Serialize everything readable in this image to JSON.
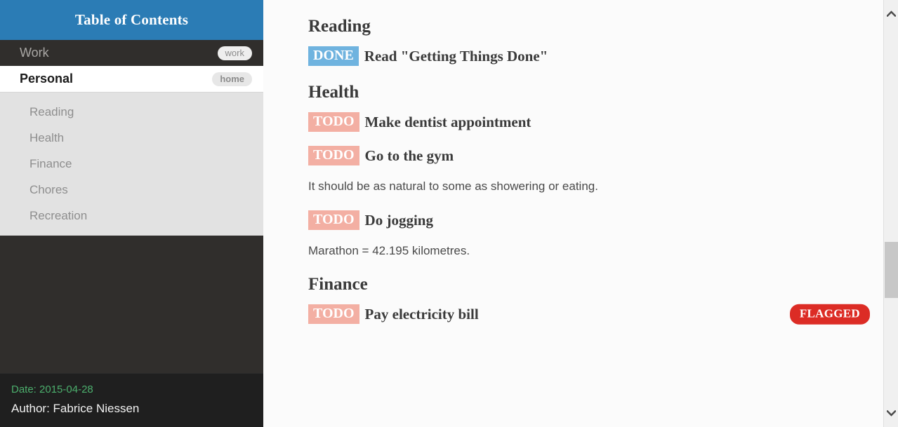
{
  "sidebar": {
    "header_title": "Table of Contents",
    "top_items": [
      {
        "label": "Work",
        "tag": "work",
        "state": "inactive"
      },
      {
        "label": "Personal",
        "tag": "home",
        "state": "active"
      }
    ],
    "children": [
      {
        "label": "Reading"
      },
      {
        "label": "Health"
      },
      {
        "label": "Finance"
      },
      {
        "label": "Chores"
      },
      {
        "label": "Recreation"
      }
    ],
    "footer": {
      "date": "Date: 2015-04-28",
      "author": "Author: Fabrice Niessen"
    }
  },
  "main": {
    "sections": [
      {
        "heading": "Reading",
        "tasks": [
          {
            "keyword": "DONE",
            "keyword_type": "done",
            "title": "Read \"Getting Things Done\"",
            "flag": ""
          }
        ],
        "paragraphs": []
      },
      {
        "heading": "Health",
        "tasks": [
          {
            "keyword": "TODO",
            "keyword_type": "todo",
            "title": "Make dentist appointment",
            "flag": ""
          },
          {
            "keyword": "TODO",
            "keyword_type": "todo",
            "title": "Go to the gym",
            "flag": ""
          }
        ],
        "paragraphs": [
          "It should be as natural to some as showering or eating.",
          "Marathon = 42.195 kilometres."
        ]
      },
      {
        "heading": "Finance",
        "tasks": [
          {
            "keyword": "TODO",
            "keyword_type": "todo",
            "title": "Pay electricity bill",
            "flag": "FLAGGED"
          }
        ],
        "paragraphs": []
      }
    ],
    "flow": {
      "reading_heading": "Reading",
      "reading_task_kw": "DONE",
      "reading_task_title": "Read \"Getting Things Done\"",
      "health_heading": "Health",
      "health_task1_kw": "TODO",
      "health_task1_title": "Make dentist appointment",
      "health_task2_kw": "TODO",
      "health_task2_title": "Go to the gym",
      "health_para1": "It should be as natural to some as showering or eating.",
      "health_task3_kw": "TODO",
      "health_task3_title": "Do jogging",
      "health_para2": "Marathon = 42.195 kilometres.",
      "finance_heading": "Finance",
      "finance_task1_kw": "TODO",
      "finance_task1_title": "Pay electricity bill",
      "finance_task1_flag": "FLAGGED"
    }
  },
  "scrollbar": {
    "up_icon": "chevron-up-icon",
    "down_icon": "chevron-down-icon"
  },
  "colors": {
    "header_blue": "#2B7CB5",
    "sidebar_dark": "#302E2C",
    "done_badge": "#6FB3DF",
    "todo_badge": "#F3AFA3",
    "flagged_badge": "#DC2C25",
    "date_green": "#4CAF6D"
  }
}
